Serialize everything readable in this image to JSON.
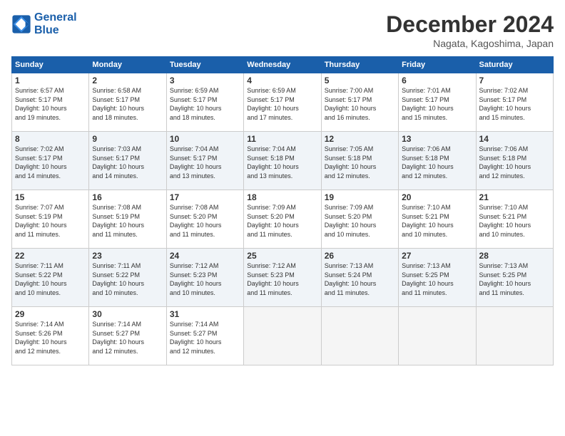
{
  "logo": {
    "line1": "General",
    "line2": "Blue"
  },
  "title": "December 2024",
  "location": "Nagata, Kagoshima, Japan",
  "weekdays": [
    "Sunday",
    "Monday",
    "Tuesday",
    "Wednesday",
    "Thursday",
    "Friday",
    "Saturday"
  ],
  "weeks": [
    [
      {
        "day": "1",
        "info": "Sunrise: 6:57 AM\nSunset: 5:17 PM\nDaylight: 10 hours\nand 19 minutes."
      },
      {
        "day": "2",
        "info": "Sunrise: 6:58 AM\nSunset: 5:17 PM\nDaylight: 10 hours\nand 18 minutes."
      },
      {
        "day": "3",
        "info": "Sunrise: 6:59 AM\nSunset: 5:17 PM\nDaylight: 10 hours\nand 18 minutes."
      },
      {
        "day": "4",
        "info": "Sunrise: 6:59 AM\nSunset: 5:17 PM\nDaylight: 10 hours\nand 17 minutes."
      },
      {
        "day": "5",
        "info": "Sunrise: 7:00 AM\nSunset: 5:17 PM\nDaylight: 10 hours\nand 16 minutes."
      },
      {
        "day": "6",
        "info": "Sunrise: 7:01 AM\nSunset: 5:17 PM\nDaylight: 10 hours\nand 15 minutes."
      },
      {
        "day": "7",
        "info": "Sunrise: 7:02 AM\nSunset: 5:17 PM\nDaylight: 10 hours\nand 15 minutes."
      }
    ],
    [
      {
        "day": "8",
        "info": "Sunrise: 7:02 AM\nSunset: 5:17 PM\nDaylight: 10 hours\nand 14 minutes."
      },
      {
        "day": "9",
        "info": "Sunrise: 7:03 AM\nSunset: 5:17 PM\nDaylight: 10 hours\nand 14 minutes."
      },
      {
        "day": "10",
        "info": "Sunrise: 7:04 AM\nSunset: 5:17 PM\nDaylight: 10 hours\nand 13 minutes."
      },
      {
        "day": "11",
        "info": "Sunrise: 7:04 AM\nSunset: 5:18 PM\nDaylight: 10 hours\nand 13 minutes."
      },
      {
        "day": "12",
        "info": "Sunrise: 7:05 AM\nSunset: 5:18 PM\nDaylight: 10 hours\nand 12 minutes."
      },
      {
        "day": "13",
        "info": "Sunrise: 7:06 AM\nSunset: 5:18 PM\nDaylight: 10 hours\nand 12 minutes."
      },
      {
        "day": "14",
        "info": "Sunrise: 7:06 AM\nSunset: 5:18 PM\nDaylight: 10 hours\nand 12 minutes."
      }
    ],
    [
      {
        "day": "15",
        "info": "Sunrise: 7:07 AM\nSunset: 5:19 PM\nDaylight: 10 hours\nand 11 minutes."
      },
      {
        "day": "16",
        "info": "Sunrise: 7:08 AM\nSunset: 5:19 PM\nDaylight: 10 hours\nand 11 minutes."
      },
      {
        "day": "17",
        "info": "Sunrise: 7:08 AM\nSunset: 5:20 PM\nDaylight: 10 hours\nand 11 minutes."
      },
      {
        "day": "18",
        "info": "Sunrise: 7:09 AM\nSunset: 5:20 PM\nDaylight: 10 hours\nand 11 minutes."
      },
      {
        "day": "19",
        "info": "Sunrise: 7:09 AM\nSunset: 5:20 PM\nDaylight: 10 hours\nand 10 minutes."
      },
      {
        "day": "20",
        "info": "Sunrise: 7:10 AM\nSunset: 5:21 PM\nDaylight: 10 hours\nand 10 minutes."
      },
      {
        "day": "21",
        "info": "Sunrise: 7:10 AM\nSunset: 5:21 PM\nDaylight: 10 hours\nand 10 minutes."
      }
    ],
    [
      {
        "day": "22",
        "info": "Sunrise: 7:11 AM\nSunset: 5:22 PM\nDaylight: 10 hours\nand 10 minutes."
      },
      {
        "day": "23",
        "info": "Sunrise: 7:11 AM\nSunset: 5:22 PM\nDaylight: 10 hours\nand 10 minutes."
      },
      {
        "day": "24",
        "info": "Sunrise: 7:12 AM\nSunset: 5:23 PM\nDaylight: 10 hours\nand 10 minutes."
      },
      {
        "day": "25",
        "info": "Sunrise: 7:12 AM\nSunset: 5:23 PM\nDaylight: 10 hours\nand 11 minutes."
      },
      {
        "day": "26",
        "info": "Sunrise: 7:13 AM\nSunset: 5:24 PM\nDaylight: 10 hours\nand 11 minutes."
      },
      {
        "day": "27",
        "info": "Sunrise: 7:13 AM\nSunset: 5:25 PM\nDaylight: 10 hours\nand 11 minutes."
      },
      {
        "day": "28",
        "info": "Sunrise: 7:13 AM\nSunset: 5:25 PM\nDaylight: 10 hours\nand 11 minutes."
      }
    ],
    [
      {
        "day": "29",
        "info": "Sunrise: 7:14 AM\nSunset: 5:26 PM\nDaylight: 10 hours\nand 12 minutes."
      },
      {
        "day": "30",
        "info": "Sunrise: 7:14 AM\nSunset: 5:27 PM\nDaylight: 10 hours\nand 12 minutes."
      },
      {
        "day": "31",
        "info": "Sunrise: 7:14 AM\nSunset: 5:27 PM\nDaylight: 10 hours\nand 12 minutes."
      },
      null,
      null,
      null,
      null
    ]
  ]
}
